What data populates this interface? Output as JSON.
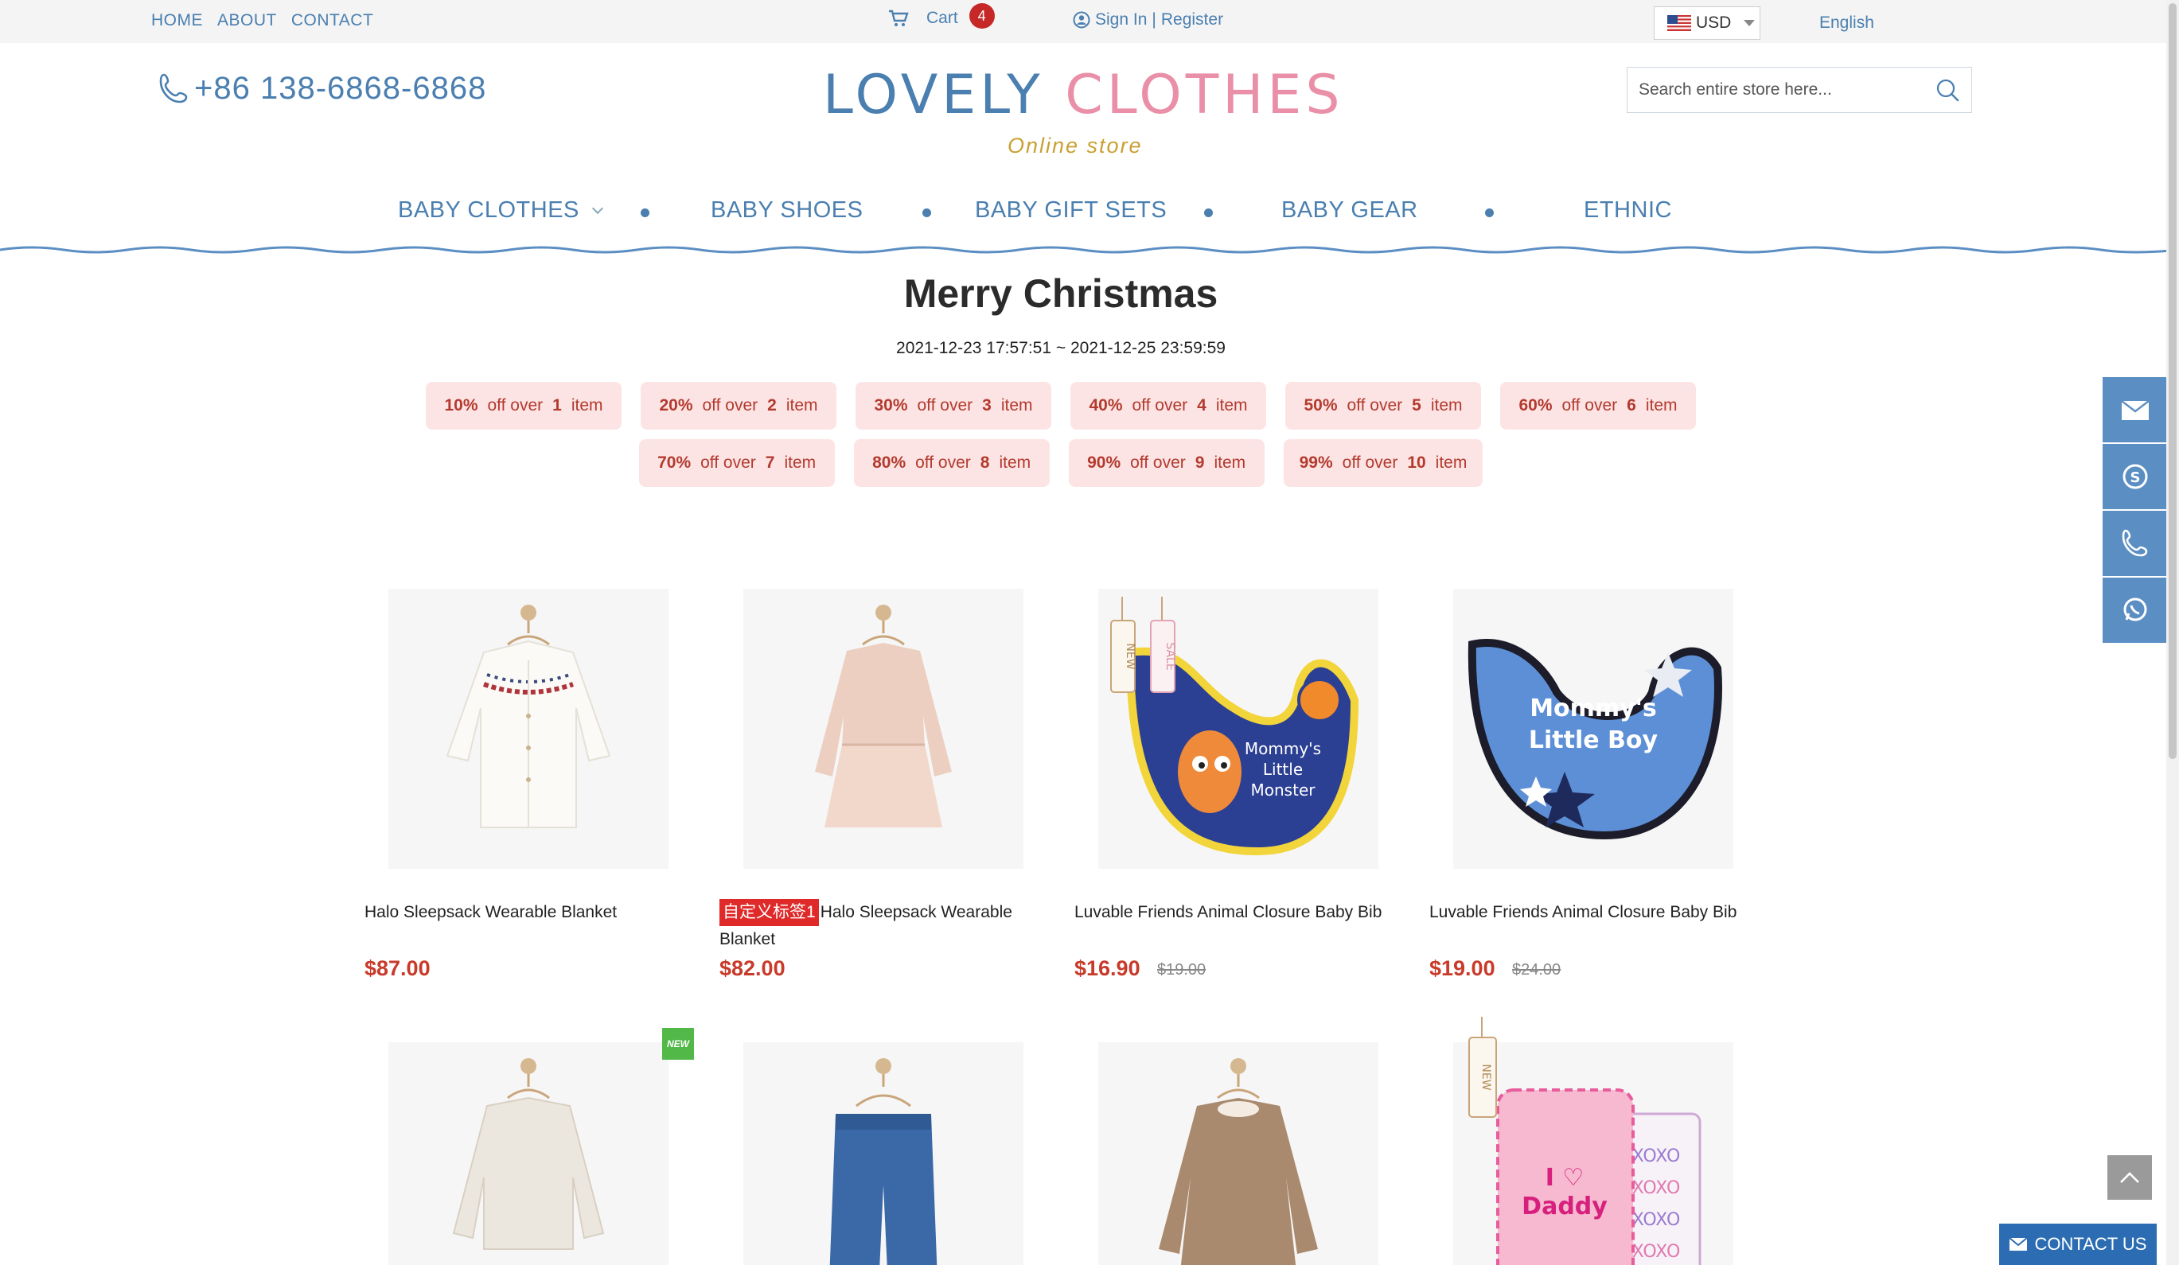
{
  "topbar": {
    "links": [
      "HOME",
      "ABOUT",
      "CONTACT"
    ],
    "cart_label": "Cart",
    "cart_count": "4",
    "signin": "Sign In",
    "separator": "|",
    "register": "Register",
    "currency": "USD",
    "language": "English"
  },
  "header": {
    "phone": "+86 138-6868-6868",
    "logo_part1": "LOVELY",
    "logo_part2": "CLOTHES",
    "logo_sub": "Online store",
    "search_placeholder": "Search entire store here..."
  },
  "nav": [
    "BABY CLOTHES",
    "BABY SHOES",
    "BABY GIFT SETS",
    "BABY GEAR",
    "ETHNIC"
  ],
  "promo": {
    "title": "Merry Christmas",
    "dates": "2021-12-23 17:57:51 ~ 2021-12-25 23:59:59",
    "off_text": "off over",
    "item_text": "item",
    "tiers": [
      {
        "pct": "10%",
        "qty": "1"
      },
      {
        "pct": "20%",
        "qty": "2"
      },
      {
        "pct": "30%",
        "qty": "3"
      },
      {
        "pct": "40%",
        "qty": "4"
      },
      {
        "pct": "50%",
        "qty": "5"
      },
      {
        "pct": "60%",
        "qty": "6"
      },
      {
        "pct": "70%",
        "qty": "7"
      },
      {
        "pct": "80%",
        "qty": "8"
      },
      {
        "pct": "90%",
        "qty": "9"
      },
      {
        "pct": "99%",
        "qty": "10"
      }
    ]
  },
  "products": [
    {
      "name": "Halo Sleepsack Wearable Blanket",
      "price": "$87.00",
      "old": "",
      "tag": ""
    },
    {
      "name": "Halo Sleepsack Wearable Blanket",
      "price": "$82.00",
      "old": "",
      "tag": "自定义标签1"
    },
    {
      "name": "Luvable Friends Animal Closure Baby Bib",
      "price": "$16.90",
      "old": "$19.00",
      "tag": ""
    },
    {
      "name": "Luvable Friends Animal Closure Baby Bib",
      "price": "$19.00",
      "old": "$24.00",
      "tag": ""
    }
  ],
  "badges": {
    "new": "NEW",
    "sale": "SALE"
  },
  "bib_text_1": [
    "Mommy's",
    "Little",
    "Monster"
  ],
  "bib_text_2": [
    "Mommy's",
    "Little Boy"
  ],
  "bib_text_3": [
    "I ♡",
    "Daddy"
  ],
  "contact_us": "CONTACT US",
  "colors": {
    "brand_blue": "#4a7fb0",
    "brand_pink": "#ea8fa8",
    "price_red": "#c83a2a",
    "tier_bg": "#fde4e4",
    "side_blue": "#5b8ec3"
  }
}
